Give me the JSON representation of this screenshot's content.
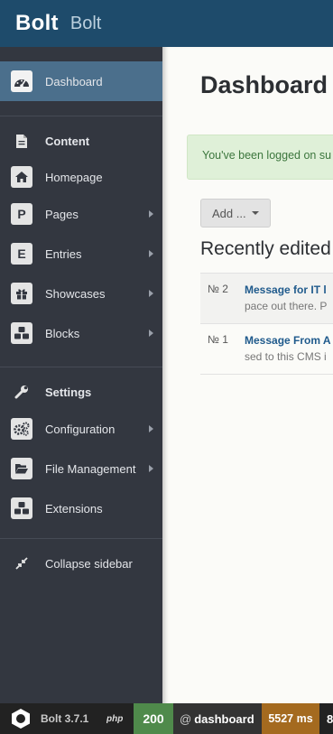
{
  "topbar": {
    "brand": "Bolt",
    "site_name": "Bolt"
  },
  "sidebar": {
    "items": [
      {
        "label": "Dashboard",
        "icon": "dashboard-icon",
        "active": true
      },
      {
        "label": "Content",
        "icon": "document-icon",
        "header": true
      },
      {
        "label": "Homepage",
        "icon": "home-icon"
      },
      {
        "label": "Pages",
        "icon_text": "P",
        "submenu": true
      },
      {
        "label": "Entries",
        "icon_text": "E",
        "submenu": true
      },
      {
        "label": "Showcases",
        "icon": "gift-icon",
        "submenu": true
      },
      {
        "label": "Blocks",
        "icon": "cubes-icon",
        "submenu": true
      },
      {
        "label": "Settings",
        "icon": "wrench-icon",
        "header": true
      },
      {
        "label": "Configuration",
        "icon": "gears-icon",
        "submenu": true
      },
      {
        "label": "File Management",
        "icon": "folder-icon",
        "submenu": true
      },
      {
        "label": "Extensions",
        "icon": "cubes-icon"
      },
      {
        "label": "Collapse sidebar",
        "icon": "compress-icon"
      }
    ]
  },
  "main": {
    "title": "Dashboard",
    "alert": "You've been logged on su",
    "add_button": "Add ...",
    "recent_title": "Recently edited",
    "records": [
      {
        "number": "№ 2",
        "title": "Message for IT l",
        "excerpt": "pace out there. P"
      },
      {
        "number": "№ 1",
        "title": "Message From A",
        "excerpt": "sed to this CMS i"
      }
    ]
  },
  "footer": {
    "version": "Bolt 3.7.1",
    "php": "php",
    "status": "200",
    "route_prefix": "@",
    "route": "dashboard",
    "time": "5527 ms",
    "extra": "8"
  },
  "colors": {
    "topbar": "#1e4b6b",
    "sidebar": "#333740",
    "sidebar_active": "#4b6f8c",
    "status_ok": "#4f8a4b",
    "time_badge": "#a46a1f",
    "link": "#1f5a8c"
  }
}
